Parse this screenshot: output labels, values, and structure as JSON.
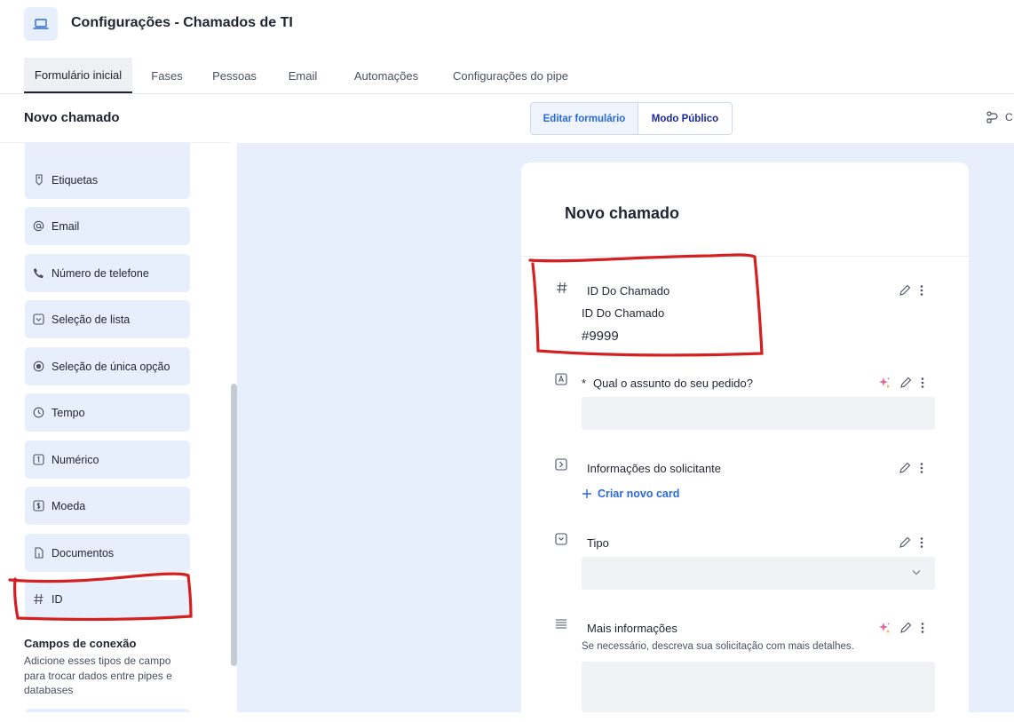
{
  "header": {
    "app_icon": "laptop-icon",
    "title": "Configurações - Chamados de TI"
  },
  "tabs": [
    {
      "label": "Formulário inicial",
      "active": true
    },
    {
      "label": "Fases"
    },
    {
      "label": "Pessoas"
    },
    {
      "label": "Email"
    },
    {
      "label": "Automações"
    },
    {
      "label": "Configurações do pipe"
    }
  ],
  "toolbar": {
    "form_name": "Novo chamado",
    "edit_label": "Editar formulário",
    "public_label": "Modo Público",
    "right_action_text": "C"
  },
  "sidebar": {
    "items": [
      {
        "label": "",
        "icon": "field-icon"
      },
      {
        "label": "Etiquetas",
        "icon": "tag-icon"
      },
      {
        "label": "Email",
        "icon": "at-icon"
      },
      {
        "label": "Número de telefone",
        "icon": "phone-icon"
      },
      {
        "label": "Seleção de lista",
        "icon": "dropdown-icon"
      },
      {
        "label": "Seleção de única opção",
        "icon": "radio-icon"
      },
      {
        "label": "Tempo",
        "icon": "clock-icon"
      },
      {
        "label": "Numérico",
        "icon": "number-icon"
      },
      {
        "label": "Moeda",
        "icon": "dollar-icon"
      },
      {
        "label": "Documentos",
        "icon": "document-icon"
      },
      {
        "label": "ID",
        "icon": "hash-icon"
      }
    ],
    "connection_title": "Campos de conexão",
    "connection_desc": "Adicione esses tipos de campo para trocar dados entre pipes e databases"
  },
  "form": {
    "title": "Novo chamado",
    "fields": [
      {
        "label": "ID Do Chamado",
        "value_label": "ID Do Chamado",
        "value": "#9999",
        "icon": "hash-icon"
      },
      {
        "label": "Qual o assunto do seu pedido?",
        "required_mark": "*",
        "icon": "text-icon"
      },
      {
        "label": "Informações do solicitante",
        "link": "Criar novo card",
        "icon": "connection-icon"
      },
      {
        "label": "Tipo",
        "icon": "dropdown-icon"
      },
      {
        "label": "Mais informações",
        "help": "Se necessário, descreva sua solicitação com mais detalhes.",
        "icon": "long-text-icon"
      }
    ]
  },
  "colors": {
    "accent": "#2a6ad8",
    "canvas_bg": "#e8effc",
    "annotation": "#d42020"
  }
}
